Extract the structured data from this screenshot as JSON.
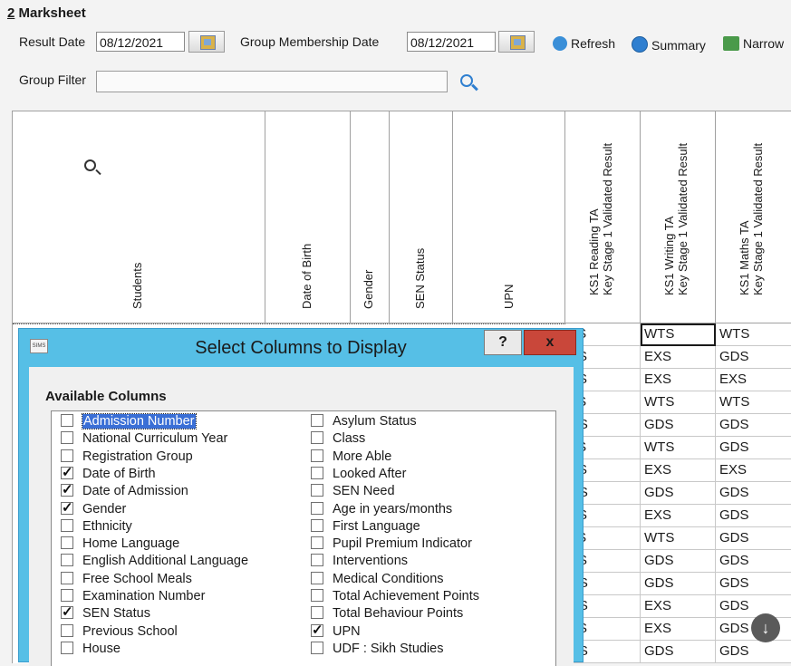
{
  "header": {
    "title_num": "2",
    "title_text": " Marksheet",
    "result_date_label": "Result Date",
    "result_date": "08/12/2021",
    "group_membership_label": "Group Membership Date",
    "group_membership_date": "08/12/2021",
    "refresh_label": "Refresh",
    "summary_label": "Summary",
    "narrow_label": "Narrow",
    "group_filter_label": "Group Filter"
  },
  "grid": {
    "columns": {
      "students": "Students",
      "dob": "Date of Birth",
      "gender": "Gender",
      "sen": "SEN Status",
      "upn": "UPN",
      "reading_1": "KS1 Reading TA",
      "reading_2": "Key Stage 1 Validated Result",
      "writing_1": "KS1 Writing TA",
      "writing_2": "Key Stage 1 Validated Result",
      "maths_1": "KS1 Maths TA",
      "maths_2": "Key Stage 1 Validated Result"
    },
    "rows": [
      [
        "TS",
        "WTS",
        "WTS"
      ],
      [
        "XS",
        "EXS",
        "GDS"
      ],
      [
        "XS",
        "EXS",
        "EXS"
      ],
      [
        "TS",
        "WTS",
        "WTS"
      ],
      [
        "DS",
        "GDS",
        "GDS"
      ],
      [
        "TS",
        "WTS",
        "GDS"
      ],
      [
        "XS",
        "EXS",
        "EXS"
      ],
      [
        "DS",
        "GDS",
        "GDS"
      ],
      [
        "XS",
        "EXS",
        "GDS"
      ],
      [
        "TS",
        "WTS",
        "GDS"
      ],
      [
        "XS",
        "GDS",
        "GDS"
      ],
      [
        "DS",
        "GDS",
        "GDS"
      ],
      [
        "DS",
        "EXS",
        "GDS"
      ],
      [
        "XS",
        "EXS",
        "GDS"
      ],
      [
        "DS",
        "GDS",
        "GDS"
      ]
    ]
  },
  "dialog": {
    "title": "Select Columns to Display",
    "help_label": "?",
    "close_label": "x",
    "section_title": "Available Columns",
    "left_items": [
      {
        "label": "Admission Number",
        "checked": false,
        "highlight": true
      },
      {
        "label": "National Curriculum Year",
        "checked": false
      },
      {
        "label": "Registration Group",
        "checked": false
      },
      {
        "label": "Date of Birth",
        "checked": true
      },
      {
        "label": "Date of Admission",
        "checked": true
      },
      {
        "label": "Gender",
        "checked": true
      },
      {
        "label": "Ethnicity",
        "checked": false
      },
      {
        "label": "Home Language",
        "checked": false
      },
      {
        "label": "English Additional Language",
        "checked": false
      },
      {
        "label": "Free School Meals",
        "checked": false
      },
      {
        "label": "Examination Number",
        "checked": false
      },
      {
        "label": "SEN Status",
        "checked": true
      },
      {
        "label": "Previous School",
        "checked": false
      },
      {
        "label": "House",
        "checked": false
      }
    ],
    "right_items": [
      {
        "label": "Asylum Status",
        "checked": false
      },
      {
        "label": "Class",
        "checked": false
      },
      {
        "label": "More Able",
        "checked": false
      },
      {
        "label": "Looked After",
        "checked": false
      },
      {
        "label": "SEN Need",
        "checked": false
      },
      {
        "label": "Age in years/months",
        "checked": false
      },
      {
        "label": "First Language",
        "checked": false
      },
      {
        "label": "Pupil Premium Indicator",
        "checked": false
      },
      {
        "label": "Interventions",
        "checked": false
      },
      {
        "label": "Medical Conditions",
        "checked": false
      },
      {
        "label": "Total Achievement Points",
        "checked": false
      },
      {
        "label": "Total Behaviour Points",
        "checked": false
      },
      {
        "label": "UPN",
        "checked": true
      },
      {
        "label": "UDF : Sikh Studies",
        "checked": false
      }
    ]
  },
  "colors": {
    "dialog_frame": "#56bfe6",
    "close_button": "#c9473a",
    "selection": "#3a6fd6"
  }
}
